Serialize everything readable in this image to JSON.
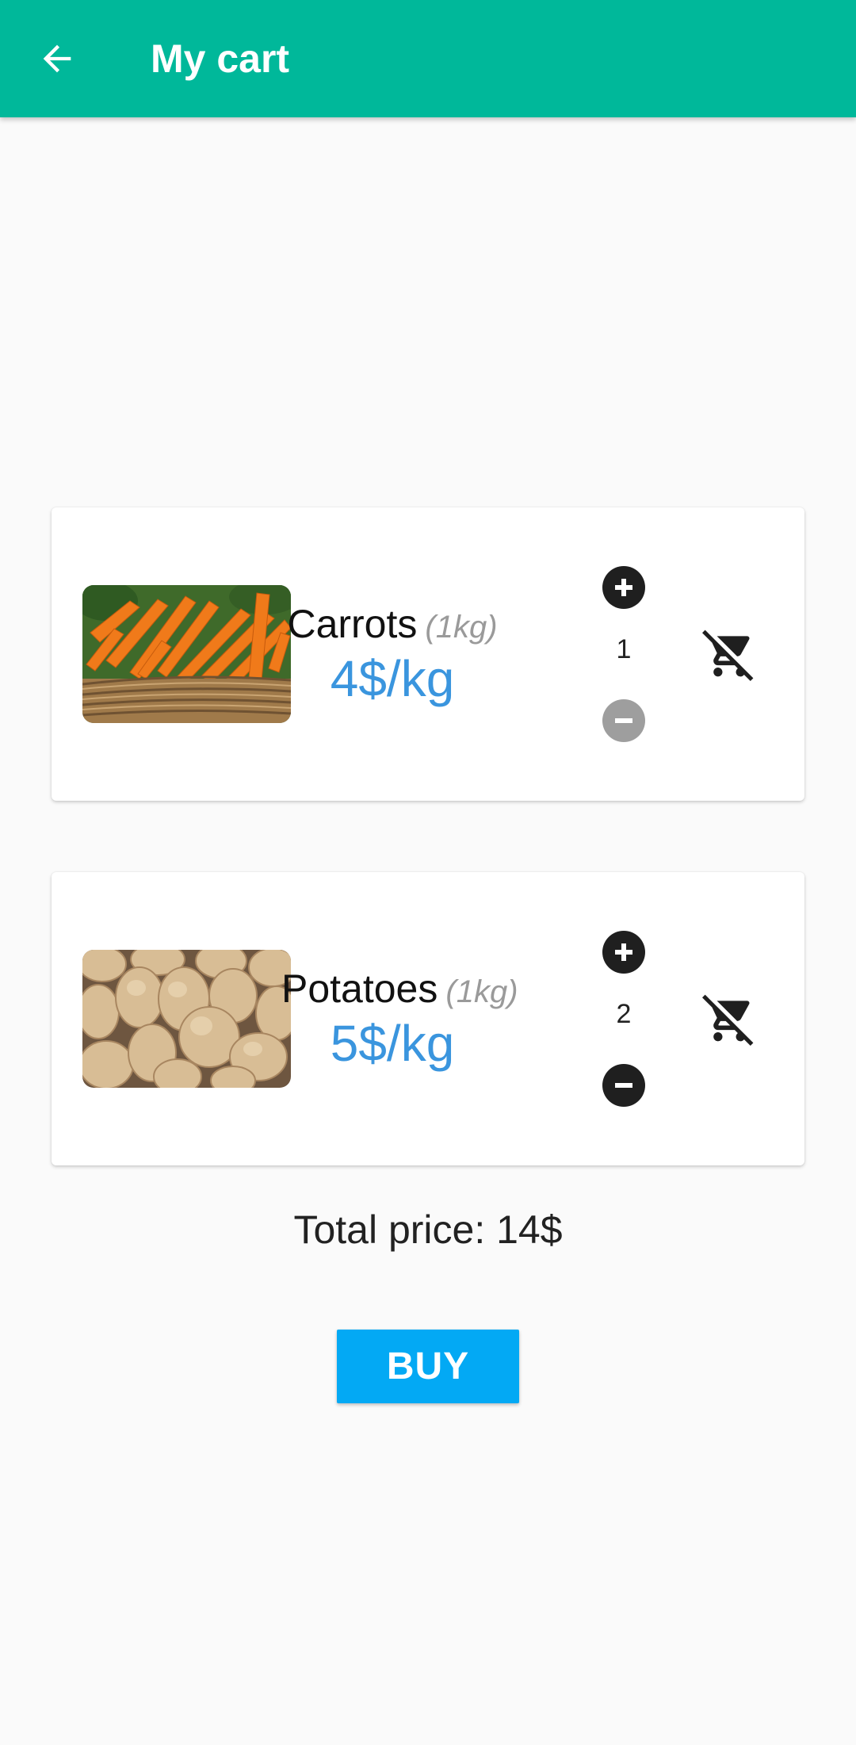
{
  "appbar": {
    "title": "My cart",
    "back_icon": "arrow-left-icon",
    "color": "#00b89a"
  },
  "cart": {
    "items": [
      {
        "name": "Carrots",
        "weight": "(1kg)",
        "price": "4$/kg",
        "quantity": "1",
        "image_icon": "carrots-image",
        "minus_state": "disabled"
      },
      {
        "name": "Potatoes",
        "weight": "(1kg)",
        "price": "5$/kg",
        "quantity": "2",
        "image_icon": "potatoes-image",
        "minus_state": "enabled"
      }
    ]
  },
  "summary": {
    "total_label": "Total price: 14$"
  },
  "actions": {
    "buy_label": "BUY",
    "buy_color": "#03a9f4"
  },
  "colors": {
    "price": "#3a95de",
    "background": "#fafafa"
  }
}
